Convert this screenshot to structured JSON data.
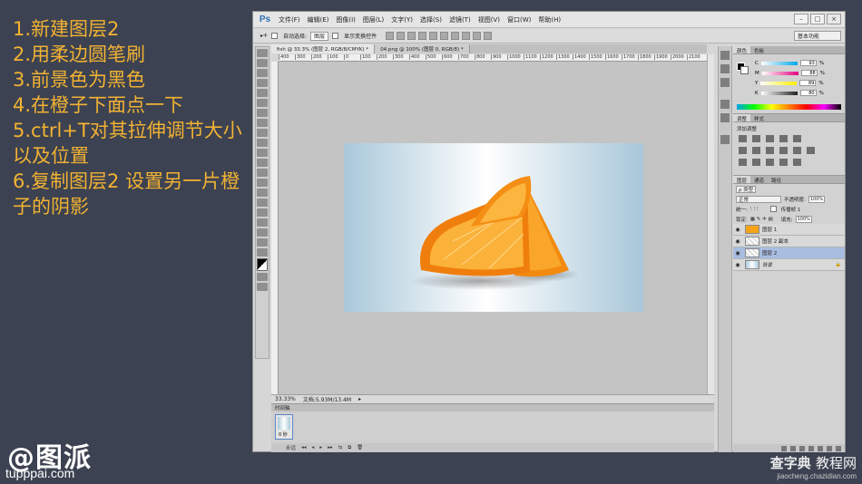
{
  "tutorial": {
    "steps": [
      "1.新建图层2",
      "2.用柔边圆笔刷",
      "3.前景色为黑色",
      "4.在橙子下面点一下",
      "5.ctrl+T对其拉伸调节大小以及位置",
      "6.复制图层2 设置另一片橙子的阴影"
    ],
    "logo": "@图派",
    "logo_url": "tupppai.com"
  },
  "photoshop": {
    "app_logo": "Ps",
    "menu": [
      "文件(F)",
      "编辑(E)",
      "图像(I)",
      "图层(L)",
      "文字(Y)",
      "选择(S)",
      "滤镜(T)",
      "视图(V)",
      "窗口(W)",
      "帮助(H)"
    ],
    "window_buttons": [
      "–",
      "□",
      "×"
    ],
    "options": {
      "auto_select_label": "自动选择:",
      "auto_select_value": "图层",
      "show_transform_label": "显示变换控件",
      "workspace": "基本功能"
    },
    "tabs": [
      "fish @ 33.3% (图层 2, RGB/8/CMYK) *",
      "04.png @ 100% (图层 0, RGB/8) *"
    ],
    "ruler_ticks": [
      "400",
      "300",
      "200",
      "100",
      "0",
      "100",
      "200",
      "300",
      "400",
      "500",
      "600",
      "700",
      "800",
      "900",
      "1000",
      "1100",
      "1200",
      "1300",
      "1400",
      "1500",
      "1600",
      "1700",
      "1800",
      "1900",
      "2000",
      "2100"
    ],
    "status": {
      "zoom": "33.33%",
      "doc": "文档:5.93M/13.4M"
    },
    "timeline": {
      "title": "时间轴",
      "frame_time": "0 秒",
      "loop": "永远",
      "controls": [
        "◂◂",
        "◂",
        "▸",
        "▸▸",
        "⇆",
        "⧉",
        "🗑"
      ]
    },
    "color_panel": {
      "tabs": [
        "颜色",
        "色板"
      ],
      "channels": [
        {
          "label": "C",
          "value": "93",
          "color": "#00a8e8"
        },
        {
          "label": "M",
          "value": "88",
          "color": "#e4007f"
        },
        {
          "label": "Y",
          "value": "89",
          "color": "#fff100"
        },
        {
          "label": "K",
          "value": "80",
          "color": "#222222"
        }
      ],
      "unit": "%"
    },
    "adjust_panel": {
      "tabs": [
        "调整",
        "样式"
      ],
      "title": "添加调整"
    },
    "layers_panel": {
      "tabs": [
        "图层",
        "通道",
        "路径"
      ],
      "filter": "ρ 类型",
      "blend": "正常",
      "opacity_label": "不透明度:",
      "opacity": "100%",
      "unify_label": "统一:",
      "propagate_label": "传播帧 1",
      "lock_label": "锁定:",
      "fill_label": "填充:",
      "fill": "100%",
      "layers": [
        {
          "name": "图层 1",
          "thumb": "orange",
          "selected": false
        },
        {
          "name": "图层 2 副本",
          "thumb": "checker",
          "selected": false
        },
        {
          "name": "图层 2",
          "thumb": "checker",
          "selected": true
        },
        {
          "name": "背景",
          "thumb": "bgimg",
          "selected": false
        }
      ]
    }
  },
  "watermark": {
    "main": "查字典",
    "sub": "教程网",
    "url": "jiaocheng.chazidian.com"
  }
}
